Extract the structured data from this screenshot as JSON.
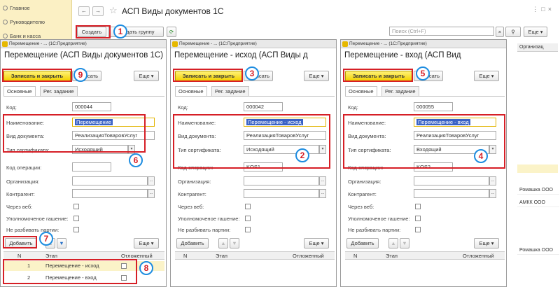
{
  "sidebar": {
    "items": [
      {
        "label": "Главное",
        "icon": "home-icon"
      },
      {
        "label": "Руководителю",
        "icon": "chart-icon"
      },
      {
        "label": "Банк и касса",
        "icon": "bank-icon"
      }
    ]
  },
  "main": {
    "title": "АСП Виды документов 1С",
    "create_label": "Создать",
    "create_group_label": "Создать группу",
    "search_placeholder": "Поиск (Ctrl+F)",
    "more_label": "Еще",
    "right_col_header": "Организац",
    "right_rows": [
      "Ромашка ООО",
      "АМКК ООО",
      "Ромашка ООО"
    ]
  },
  "windows": [
    {
      "tab_title": "Перемещение - ... (1С:Предприятие)",
      "form_title": "Перемещение (АСП Виды документов 1С)",
      "save_close_label": "Записать и закрыть",
      "write_label": "Записать",
      "more_label": "Еще",
      "tabs": [
        "Основные",
        "Рег. задание"
      ],
      "fields": {
        "code_label": "Код:",
        "code_value": "000044",
        "name_label": "Наименование:",
        "name_value": "Перемещение",
        "doctype_label": "Вид документа:",
        "doctype_value": "РеализацияТоваровУслуг",
        "cert_label": "Тип сертификата:",
        "cert_value": "Исходящий",
        "opcode_label": "Код операции:",
        "opcode_value": "",
        "org_label": "Организация:",
        "contr_label": "Контрагент:",
        "web_label": "Через веб:",
        "auth_label": "Уполномоченое гашение:",
        "nosplit_label": "Не разбивать партии:"
      },
      "add_label": "Добавить",
      "grid_headers": [
        "N",
        "Этап",
        "Отложенный"
      ],
      "rows": [
        {
          "n": "1",
          "stage": "Перемещение - исход"
        },
        {
          "n": "2",
          "stage": "Перемещение - вход"
        }
      ]
    },
    {
      "tab_title": "Перемещение - ... (1С:Предприятие)",
      "form_title": "Перемещение - исход (АСП Виды д",
      "save_close_label": "Записать и закрыть",
      "write_label": "Записать",
      "more_label": "Еще",
      "tabs": [
        "Основные",
        "Рег. задание"
      ],
      "fields": {
        "code_label": "Код:",
        "code_value": "000042",
        "name_label": "Наименование:",
        "name_value": "Перемещение - исход",
        "doctype_label": "Вид документа:",
        "doctype_value": "РеализацияТоваровУслуг",
        "cert_label": "Тип сертификата:",
        "cert_value": "Исходящий",
        "opcode_label": "Код операции:",
        "opcode_value": "KOS1",
        "org_label": "Организация:",
        "contr_label": "Контрагент:",
        "web_label": "Через веб:",
        "auth_label": "Уполномоченое гашение:",
        "nosplit_label": "Не разбивать партии:"
      },
      "add_label": "Добавить",
      "grid_headers": [
        "N",
        "Этап",
        "Отложенный"
      ],
      "rows": []
    },
    {
      "tab_title": "Перемещение - ... (1С:Предприятие)",
      "form_title": "Перемещение - вход (АСП Вид",
      "save_close_label": "Записать и закрыть",
      "write_label": "Записать",
      "more_label": "Еще",
      "tabs": [
        "Основные",
        "Рег. задание"
      ],
      "fields": {
        "code_label": "Код:",
        "code_value": "000055",
        "name_label": "Наименование:",
        "name_value": "Перемещение - вход",
        "doctype_label": "Вид документа:",
        "doctype_value": "РеализацияТоваровУслуг",
        "cert_label": "Тип сертификата:",
        "cert_value": "Входящий",
        "opcode_label": "Код операции:",
        "opcode_value": "KOS2",
        "org_label": "Организация:",
        "contr_label": "Контрагент:",
        "web_label": "Через веб:",
        "auth_label": "Уполномоченое гашение:",
        "nosplit_label": "Не разбивать партии:"
      },
      "add_label": "Добавить",
      "grid_headers": [
        "N",
        "Этап",
        "Отложенный"
      ],
      "rows": []
    }
  ],
  "markers": [
    "1",
    "2",
    "3",
    "4",
    "5",
    "6",
    "7",
    "8",
    "9"
  ],
  "colors": {
    "accent_yellow": "#f3d100",
    "annotation_red": "#d61f26",
    "marker_blue": "#1d8ce0",
    "selection_blue": "#3a63c6"
  }
}
